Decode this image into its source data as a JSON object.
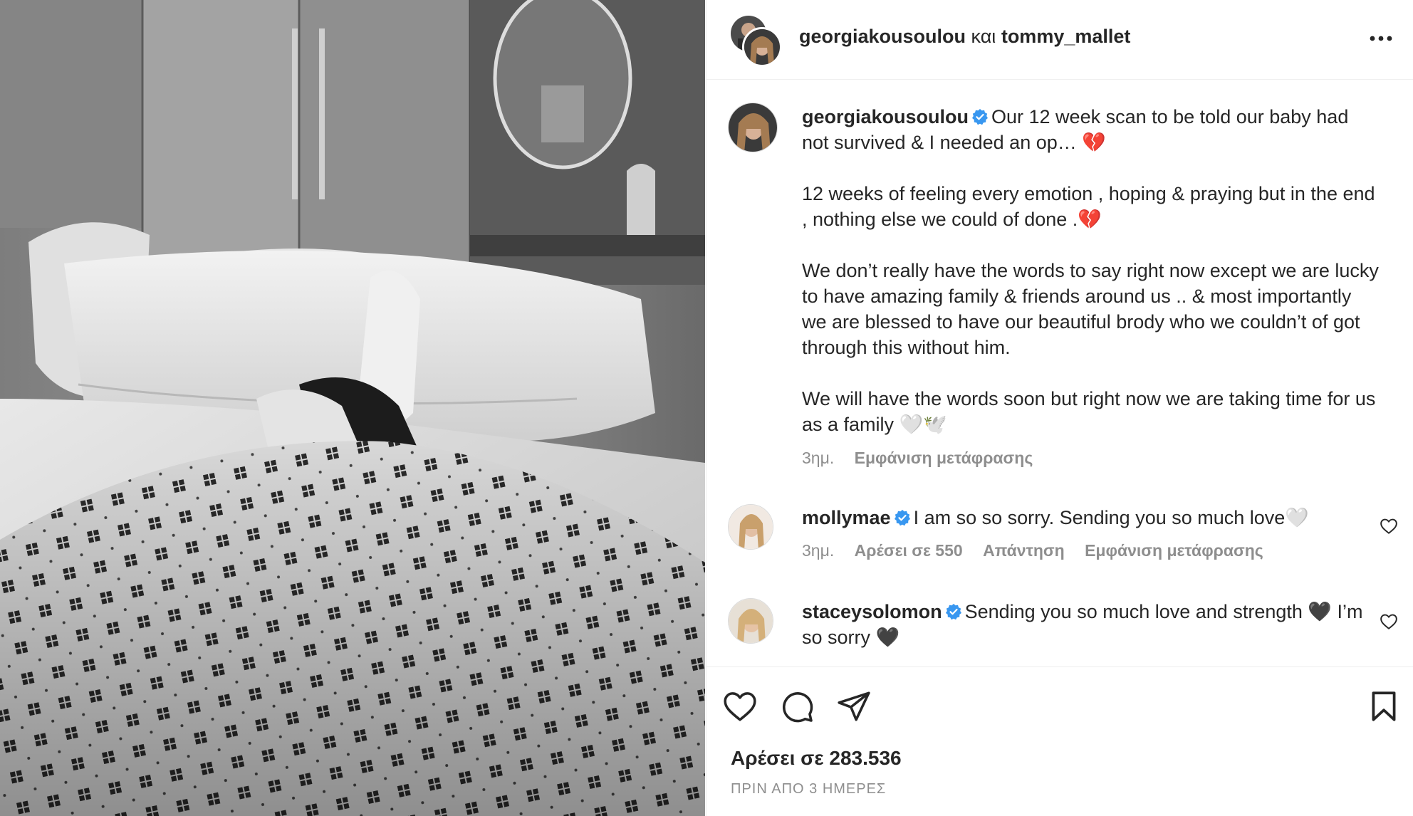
{
  "header": {
    "user1": "georgiakousoulou",
    "conjunction": "και",
    "user2": "tommy_mallet",
    "more_icon": "more-horizontal-icon"
  },
  "caption": {
    "username": "georgiakousoulou",
    "verified": true,
    "paragraphs": [
      "Our 12 week scan to be told our baby had not survived & I needed an op… 💔",
      "12 weeks of feeling every emotion , hoping & praying but in the end , nothing else we could of done .💔",
      "We don’t really have the words to say right now except we are lucky to have amazing family & friends around us .. & most importantly we are blessed to have our beautiful brody who we couldn’t of got through this without him.",
      "We will have the words soon but right now we are taking time for us as a family 🤍🕊️"
    ],
    "time": "3ημ.",
    "translation": "Εμφάνιση μετάφρασης"
  },
  "comments": [
    {
      "username": "mollymae",
      "verified": true,
      "text": "I am so so sorry. Sending you so much love🤍",
      "time": "3ημ.",
      "likes": "Αρέσει σε 550",
      "reply": "Απάντηση",
      "translation": "Εμφάνιση μετάφρασης"
    },
    {
      "username": "staceysolomon",
      "verified": true,
      "text": "Sending you so much love and strength 🖤 I’m so sorry 🖤"
    }
  ],
  "actions": {
    "like_icon": "heart-icon",
    "comment_icon": "comment-icon",
    "share_icon": "send-icon",
    "save_icon": "bookmark-icon"
  },
  "likes_label": "Αρέσει σε 283.536",
  "date_label": "ΠΡΙΝ ΑΠΟ 3 ΗΜΕΡΕΣ",
  "colors": {
    "verified": "#3897f0",
    "text": "#262626",
    "secondary": "#8e8e8e",
    "divider": "#efefef"
  }
}
